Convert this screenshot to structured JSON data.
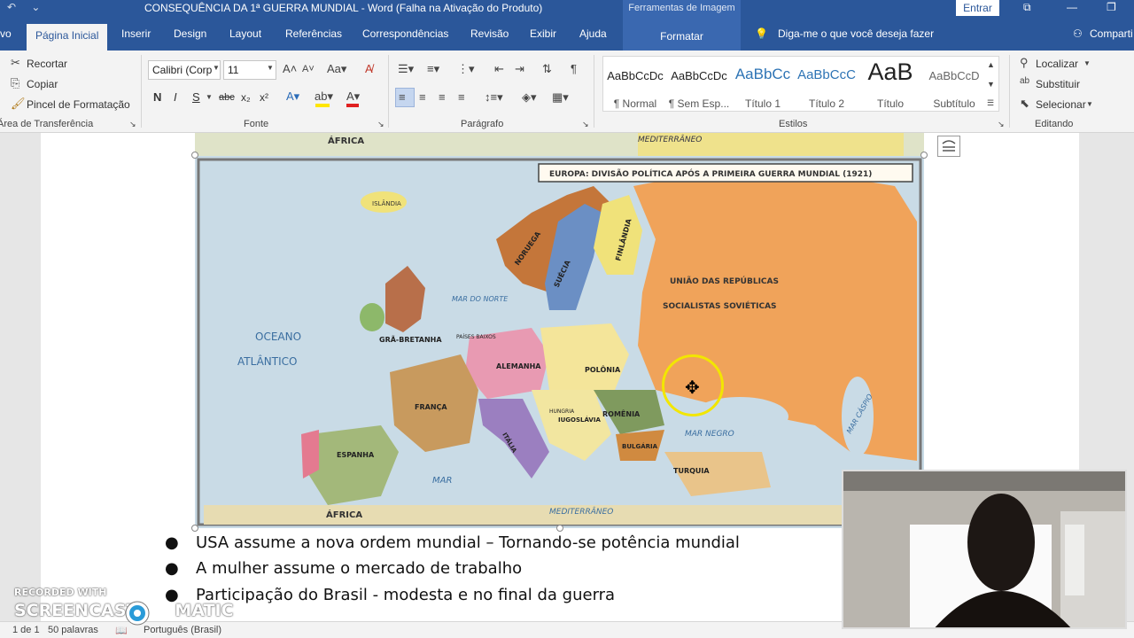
{
  "titlebar": {
    "undo_icon": "undo-icon",
    "customize_icon": "qat-customize-icon",
    "title": "CONSEQUÊNCIA DA 1ª GUERRA MUNDIAL  -  Word (Falha na Ativação do Produto)",
    "context_group": "Ferramentas de Imagem",
    "signin": "Entrar"
  },
  "tabs": {
    "file": "vo",
    "home": "Página Inicial",
    "insert": "Inserir",
    "design": "Design",
    "layout": "Layout",
    "references": "Referências",
    "mailings": "Correspondências",
    "review": "Revisão",
    "view": "Exibir",
    "help": "Ajuda",
    "format": "Formatar",
    "tell_me": "Diga-me o que você deseja fazer",
    "share": "Comparti"
  },
  "clipboard": {
    "cut": "Recortar",
    "copy": "Copiar",
    "format_painter": "Pincel de Formatação",
    "label": "Área de Transferência"
  },
  "font": {
    "name": "Calibri (Corp",
    "size": "11",
    "bold": "N",
    "italic": "I",
    "underline": "S",
    "strike": "abc",
    "subscript": "x₂",
    "superscript": "x²",
    "label": "Fonte"
  },
  "paragraph": {
    "label": "Parágrafo"
  },
  "styles": {
    "items": [
      {
        "preview": "AaBbCcDc",
        "name": "¶ Normal"
      },
      {
        "preview": "AaBbCcDc",
        "name": "¶ Sem Esp..."
      },
      {
        "preview": "AaBbCc",
        "name": "Título 1"
      },
      {
        "preview": "AaBbCcC",
        "name": "Título 2"
      },
      {
        "preview": "AaB",
        "name": "Título"
      },
      {
        "preview": "AaBbCcD",
        "name": "Subtítulo"
      }
    ],
    "label": "Estilos"
  },
  "editing": {
    "find": "Localizar",
    "replace": "Substituir",
    "select": "Selecionar",
    "label": "Editando"
  },
  "map": {
    "title": "EUROPA: DIVISÃO POLÍTICA APÓS A PRIMEIRA GUERRA MUNDIAL (1921)",
    "labels": {
      "africa_top": "ÁFRICA",
      "africa_bottom": "ÁFRICA",
      "islandia": "ISLÂNDIA",
      "oceano": "OCEANO",
      "atlantico": "ATLÂNTICO",
      "mar_do_norte": "MAR DO NORTE",
      "gra_bretanha": "GRÃ-BRETANHA",
      "paises_baixos": "PAÍSES BAIXOS",
      "alemanha": "ALEMANHA",
      "polonia": "POLÔNIA",
      "franca": "FRANÇA",
      "espanha": "ESPANHA",
      "italia": "ITÁLIA",
      "iugoslavia": "IUGOSLÁVIA",
      "hungria": "HUNGRIA",
      "romenia": "ROMÊNIA",
      "bulgaria": "BULGÁRIA",
      "turquia": "TURQUIA",
      "noruega": "NORUEGA",
      "suecia": "SUÉCIA",
      "finlandia": "FINLÂNDIA",
      "urss_1": "UNIÃO DAS REPÚBLICAS",
      "urss_2": "SOCIALISTAS   SOVIÉTICAS",
      "mar_negro": "MAR NEGRO",
      "mar_caspio": "MAR CÁSPIO",
      "mar_med": "MAR",
      "mediterraneo": "MEDITERRÂNEO",
      "mar_med_top": "MEDITERRÂNEO"
    }
  },
  "document": {
    "bullets": [
      "USA assume a nova ordem mundial – Tornando-se potência mundial",
      "A mulher assume o mercado de trabalho",
      "Participação do Brasil - modesta e no final da guerra"
    ]
  },
  "status": {
    "page": "1 de 1",
    "words": "50 palavras",
    "language": "Português (Brasil)"
  },
  "watermark": {
    "line1": "RECORDED WITH",
    "line2a": "SCREENCAST",
    "line2b": "MATIC"
  },
  "colors": {
    "word_blue": "#2b579a",
    "ribbon_bg": "#f3f3f3",
    "cursor_ring": "#f2e600"
  }
}
